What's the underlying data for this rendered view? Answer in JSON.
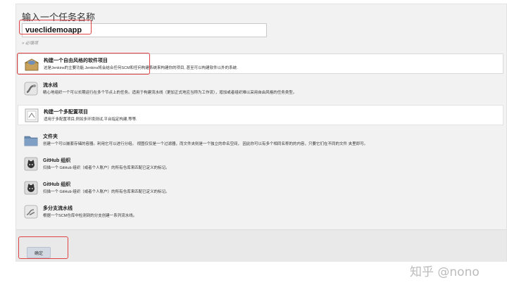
{
  "form": {
    "title": "输入一个任务名称",
    "name_value": "vueclidemoapp",
    "required_hint": "» 必填项"
  },
  "items": [
    {
      "title": "构建一个自由风格的软件项目",
      "desc": "这是Jenkins的主要功能.Jenkins将会结合任何SCM和任何构建系统来构建你的项目, 甚至可以构建软件以外的系统.",
      "icon": "freestyle-box-icon"
    },
    {
      "title": "流水线",
      "desc": "精心地组织一个可以长期运行在多个节点上的任务。适用于构建流水线（更加正式地应当称为工作流），增加或者组织难以采用自由风格的任务类型。",
      "icon": "pipeline-icon"
    },
    {
      "title": "构建一个多配置项目",
      "desc": "适用于多配置项目,例如多环境测试,平台指定构建,等等.",
      "icon": "multi-config-icon"
    },
    {
      "title": "文件夹",
      "desc": "创建一个可以嵌套存储的容器。利用它可以进行分组。 视图仅仅是一个过滤器，而文件夹则是一个独立的命名空间， 因此你可以有多个相同名称的的内容，只要它们在不同的文件 夹里即可。",
      "icon": "folder-icon"
    },
    {
      "title": "GitHub 组织",
      "desc": "扫描一个 GitHub 组织（或者个人账户）的所有仓库来匹配已定义的标记。",
      "icon": "github-org-icon"
    },
    {
      "title": "GitHub 组织",
      "desc": "扫描一个 GitHub 组织（或者个人账户）的所有仓库来匹配已定义的标记。",
      "icon": "github-org-icon"
    },
    {
      "title": "多分支流水线",
      "desc": "根据一个SCM仓库中检测到的分支创建一系列流水线。",
      "icon": "multibranch-icon"
    }
  ],
  "footer": {
    "ok_label": "确定"
  },
  "watermark": "知乎 @nono",
  "colors": {
    "highlight": "#e04343",
    "panel": "#f2f2f2",
    "button": "#d2d9e3"
  }
}
